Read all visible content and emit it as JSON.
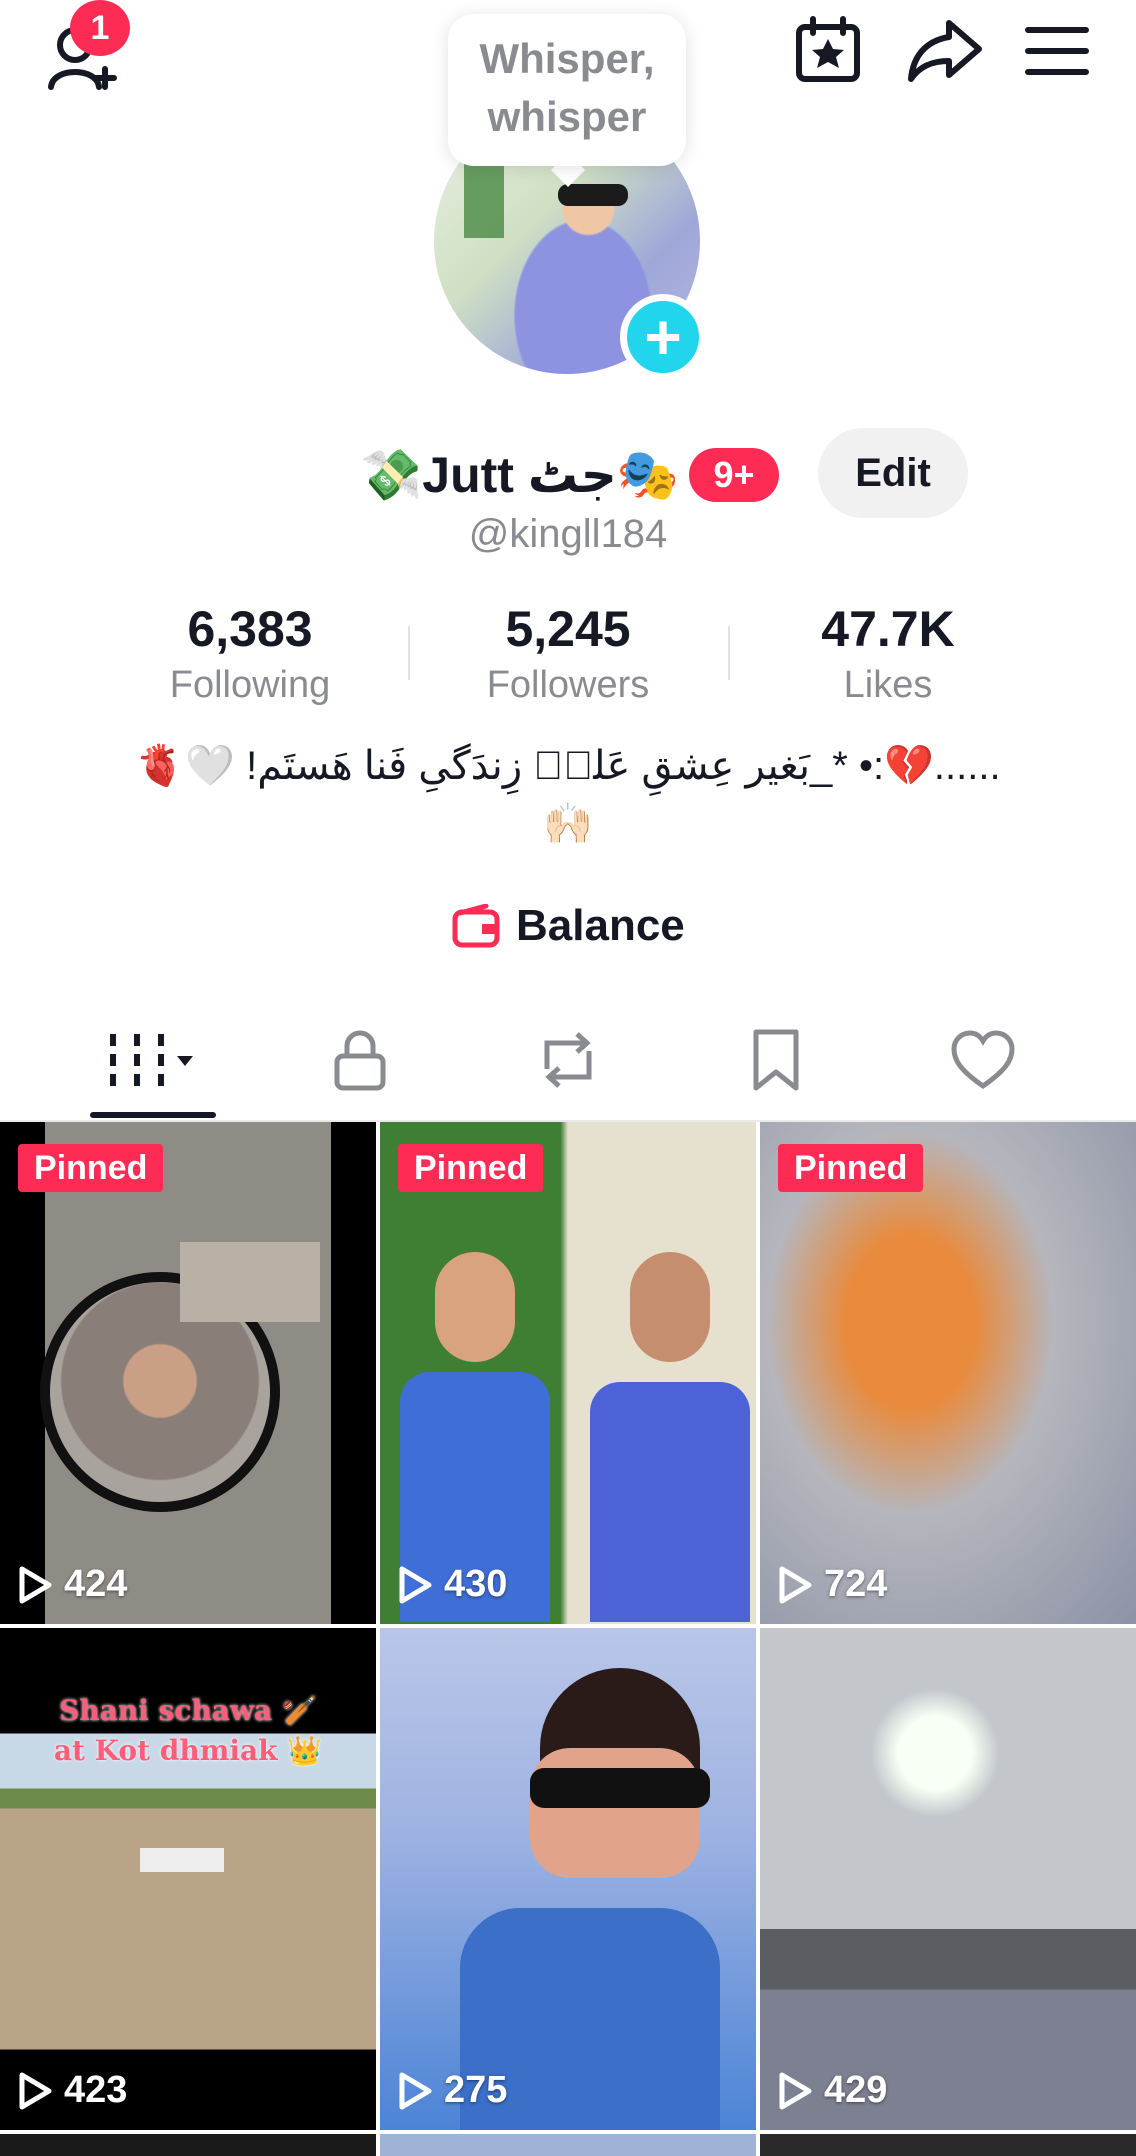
{
  "top_bar": {
    "add_friend_badge": "1",
    "icons": [
      "add-friend-icon",
      "calendar-star-icon",
      "share-icon",
      "menu-icon"
    ]
  },
  "whisper_bubble": {
    "line1": "Whisper,",
    "line2": "whisper"
  },
  "profile": {
    "display_name": "💸Jutt جٹ🎭",
    "level_badge": "9+",
    "edit_label": "Edit",
    "username": "@kingll184",
    "stats": [
      {
        "value": "6,383",
        "label": "Following"
      },
      {
        "value": "5,245",
        "label": "Followers"
      },
      {
        "value": "47.7K",
        "label": "Likes"
      }
    ],
    "bio_line1": "......💔:• *_بَغیر عِشقِ عَلیؑ زِندَگیِ فَنا ھَستَم! 🤍🫀",
    "bio_line2": "🙌🏻",
    "balance_label": "Balance"
  },
  "tabs": [
    "videos-tab",
    "private-tab",
    "reposts-tab",
    "favorites-tab",
    "liked-tab"
  ],
  "videos": [
    {
      "pinned": "Pinned",
      "views": "424"
    },
    {
      "pinned": "Pinned",
      "views": "430"
    },
    {
      "pinned": "Pinned",
      "views": "724"
    },
    {
      "caption1": "Shani schawa 🏏",
      "caption2": "at Kot dhmiak 👑",
      "views": "423"
    },
    {
      "views": "275"
    },
    {
      "views": "429"
    }
  ],
  "colors": {
    "accent": "#fe2c55",
    "plus": "#20d5ec",
    "text": "#161823",
    "muted": "#8a8b91"
  }
}
